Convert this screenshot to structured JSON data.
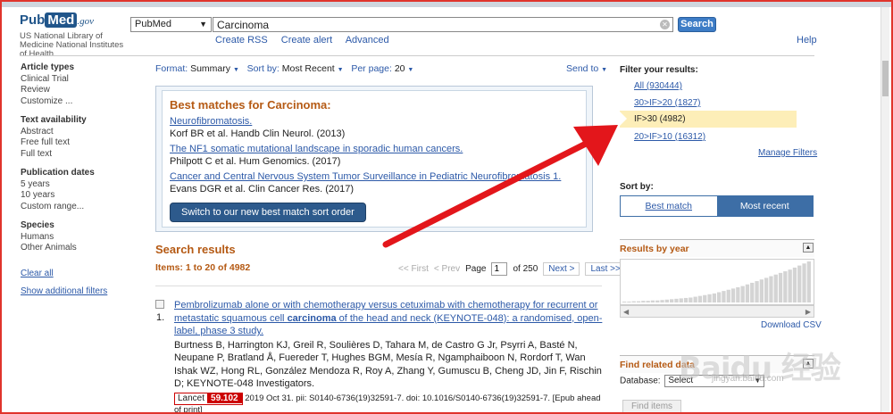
{
  "header": {
    "logo_pub": "Pub",
    "logo_med": "Med",
    "logo_gov": ".gov",
    "nlm": "US National Library of Medicine National Institutes of Health",
    "db_select": "PubMed",
    "search_value": "Carcinoma",
    "search_button": "Search",
    "links": [
      "Create RSS",
      "Create alert",
      "Advanced"
    ],
    "help": "Help"
  },
  "sidebar": {
    "sections": [
      {
        "heading": "Article types",
        "items": [
          "Clinical Trial",
          "Review",
          "Customize ..."
        ]
      },
      {
        "heading": "Text availability",
        "items": [
          "Abstract",
          "Free full text",
          "Full text"
        ]
      },
      {
        "heading": "Publication dates",
        "items": [
          "5 years",
          "10 years",
          "Custom range..."
        ]
      },
      {
        "heading": "Species",
        "items": [
          "Humans",
          "Other Animals"
        ]
      }
    ],
    "clear_all": "Clear all",
    "show_additional": "Show additional filters"
  },
  "format_bar": {
    "format_label": "Format:",
    "format_value": "Summary",
    "sort_label": "Sort by:",
    "sort_value": "Most Recent",
    "perpage_label": "Per page:",
    "perpage_value": "20",
    "send_to": "Send to"
  },
  "best_matches": {
    "title": "Best matches for Carcinoma:",
    "items": [
      {
        "title": "Neurofibromatosis.",
        "source": "Korf BR et al. Handb Clin Neurol. (2013)"
      },
      {
        "title": "The NF1 somatic mutational landscape in sporadic human cancers.",
        "source": "Philpott C et al. Hum Genomics. (2017)"
      },
      {
        "title": "Cancer and Central Nervous System Tumor Surveillance in Pediatric Neurofibromatosis 1.",
        "source": "Evans DGR et al. Clin Cancer Res. (2017)"
      }
    ],
    "switch_button": "Switch to our new best match sort order"
  },
  "results": {
    "title": "Search results",
    "count": "Items: 1 to 20 of 4982",
    "pager": {
      "first": "<< First",
      "prev": "< Prev",
      "page_label": "Page",
      "page_value": "1",
      "of": "of 250",
      "next": "Next >",
      "last": "Last >>"
    },
    "items": [
      {
        "num": "1.",
        "title_pre": "Pembrolizumab alone or with chemotherapy versus cetuximab with chemotherapy for recurrent or metastatic squamous cell ",
        "title_bold": "carcinoma",
        "title_post": " of the head and neck (KEYNOTE-048): a randomised, open-label, phase 3 study.",
        "authors": "Burtness B, Harrington KJ, Greil R, Soulières D, Tahara M, de Castro G Jr, Psyrri A, Basté N, Neupane P, Bratland Å, Fuereder T, Hughes BGM, Mesía R, Ngamphaiboon N, Rordorf T, Wan Ishak WZ, Hong RL, González Mendoza R, Roy A, Zhang Y, Gumuscu B, Cheng JD, Jin F, Rischin D; KEYNOTE-048 Investigators.",
        "journal": "Lancet",
        "impact_factor": "59.102",
        "citation": " 2019 Oct 31. pii: S0140-6736(19)32591-7. doi: 10.1016/S0140-6736(19)32591-7. [Epub ahead of print]"
      }
    ]
  },
  "filters": {
    "heading": "Filter your results:",
    "items": [
      "All (930444)",
      "30>IF>20 (1827)",
      "IF>30 (4982)",
      "20>IF>10 (16312)"
    ],
    "selected_index": 2,
    "manage": "Manage Filters"
  },
  "sort_by": {
    "heading": "Sort by:",
    "best_match": "Best match",
    "most_recent": "Most recent",
    "active": "Most recent"
  },
  "results_by_year": {
    "title": "Results by year",
    "download": "Download CSV",
    "bar_levels": [
      0.02,
      0.02,
      0.03,
      0.03,
      0.04,
      0.04,
      0.05,
      0.05,
      0.06,
      0.07,
      0.08,
      0.09,
      0.1,
      0.11,
      0.12,
      0.14,
      0.16,
      0.18,
      0.2,
      0.22,
      0.25,
      0.28,
      0.31,
      0.34,
      0.37,
      0.4,
      0.44,
      0.48,
      0.52,
      0.56,
      0.6,
      0.64,
      0.68,
      0.72,
      0.76,
      0.8,
      0.85,
      0.9,
      0.95,
      1.0
    ]
  },
  "related_data": {
    "title": "Find related data",
    "database_label": "Database:",
    "database_value": "Select",
    "find_button": "Find items"
  },
  "watermark": {
    "text": "Baidu 经验",
    "url": "jingyan.baidu.com"
  },
  "colors": {
    "accent_blue": "#2c59a8",
    "heading_orange": "#b55a14",
    "arrow_red": "#e3161b",
    "selected_filter_bg": "#fdeeb8"
  }
}
